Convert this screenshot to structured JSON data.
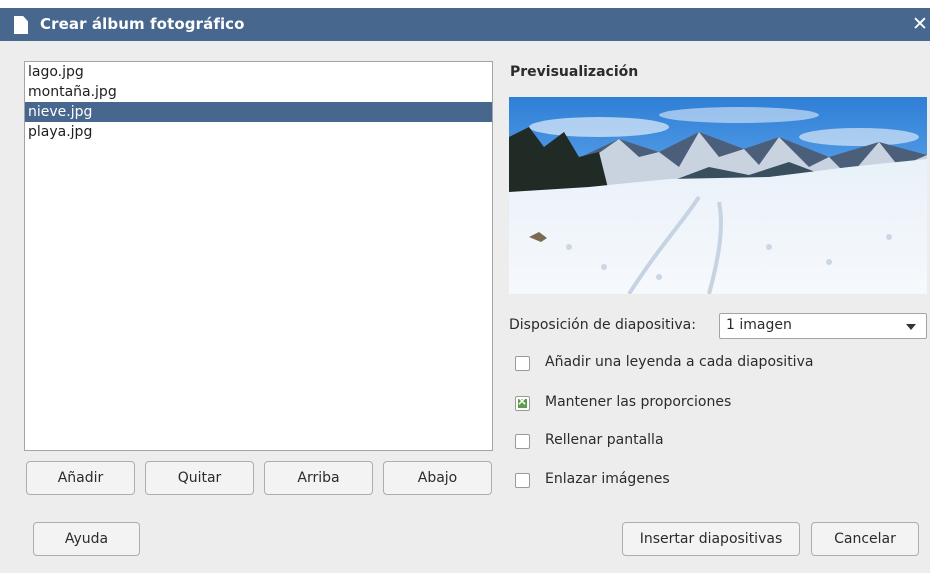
{
  "window": {
    "title": "Crear álbum fotográfico",
    "close_glyph": "✕"
  },
  "files": {
    "items": [
      {
        "label": "lago.jpg",
        "selected": false
      },
      {
        "label": "montaña.jpg",
        "selected": false
      },
      {
        "label": "nieve.jpg",
        "selected": true
      },
      {
        "label": "playa.jpg",
        "selected": false
      }
    ]
  },
  "list_buttons": {
    "add": "Añadir",
    "remove": "Quitar",
    "up": "Arriba",
    "down": "Abajo"
  },
  "preview": {
    "label": "Previsualización",
    "image_subject": "snowy mountain landscape"
  },
  "layout": {
    "label": "Disposición de diapositiva:",
    "selected": "1 imagen"
  },
  "options": {
    "caption": {
      "label": "Añadir una leyenda a cada diapositiva",
      "checked": false
    },
    "keep_ratio": {
      "label": "Mantener las proporciones",
      "checked": true
    },
    "fill_screen": {
      "label": "Rellenar pantalla",
      "checked": false
    },
    "link_images": {
      "label": "Enlazar imágenes",
      "checked": false
    }
  },
  "footer": {
    "help": "Ayuda",
    "insert": "Insertar diapositivas",
    "cancel": "Cancelar"
  },
  "colors": {
    "titlebar": "#48678f",
    "selection": "#48678f",
    "check_green": "#5b9e4c"
  }
}
